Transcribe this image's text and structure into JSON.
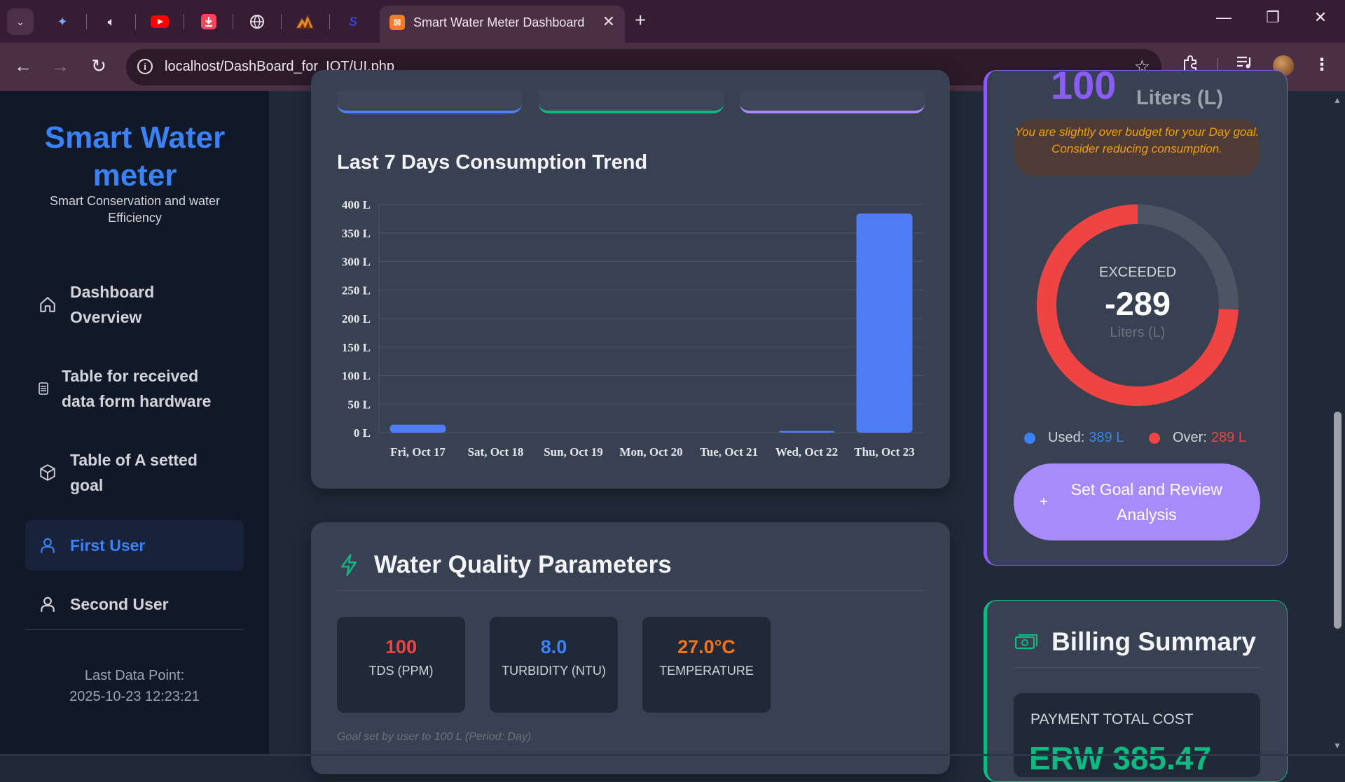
{
  "browser": {
    "active_tab_title": "Smart Water Meter Dashboard",
    "url": "localhost/DashBoard_for_IOT/UI.php",
    "pinned_tabs": [
      "gemini-icon",
      "audio-icon",
      "youtube-icon",
      "download-icon",
      "globe-icon",
      "matlab-icon",
      "s-icon"
    ]
  },
  "sidebar": {
    "brand": "Smart Water meter",
    "tagline": "Smart Conservation and water Efficiency",
    "items": [
      {
        "label": "Dashboard Overview",
        "icon": "home-icon",
        "active": false
      },
      {
        "label": "Table for received data form hardware",
        "icon": "list-icon",
        "active": false
      },
      {
        "label": "Table of A setted goal",
        "icon": "cube-icon",
        "active": false
      },
      {
        "label": "First User",
        "icon": "user-icon",
        "active": true
      },
      {
        "label": "Second User",
        "icon": "user-icon",
        "active": false
      }
    ],
    "last_point_label": "Last Data Point:",
    "last_point_value": "2025-10-23 12:23:21"
  },
  "chart_data": {
    "type": "bar",
    "title": "Last 7 Days Consumption Trend",
    "categories": [
      "Fri, Oct 17",
      "Sat, Oct 18",
      "Sun, Oct 19",
      "Mon, Oct 20",
      "Tue, Oct 21",
      "Wed, Oct 22",
      "Thu, Oct 23"
    ],
    "values": [
      14,
      0,
      0,
      0,
      0,
      3,
      384
    ],
    "ylim": [
      0,
      400
    ],
    "yticks": [
      0,
      50,
      100,
      150,
      200,
      250,
      300,
      350,
      400
    ],
    "ytick_suffix": " L",
    "grid": true,
    "colors": {
      "bar": "#4f7df5",
      "grid": "#4b5563",
      "text": "#e5e7eb"
    }
  },
  "water_quality": {
    "title": "Water Quality Parameters",
    "params": [
      {
        "value": "100",
        "label": "TDS (PPM)",
        "color": "#ef4444"
      },
      {
        "value": "8.0",
        "label": "TURBIDITY (NTU)",
        "color": "#3b82f6"
      },
      {
        "value": "27.0°C",
        "label": "TEMPERATURE",
        "color": "#f97316"
      }
    ],
    "goal_note": "Goal set by user to 100 L (Period: Day)."
  },
  "goal": {
    "big_value": "100",
    "big_unit": "Liters (L)",
    "warning": "You are slightly over budget for your Day goal. Consider reducing consumption.",
    "donut_label": "EXCEEDED",
    "donut_value": "-289",
    "donut_unit": "Liters (L)",
    "used_fraction": 0.743,
    "over_fraction": 0.257,
    "legend_used_label": "Used:",
    "legend_used_value": "389 L",
    "legend_over_label": "Over:",
    "legend_over_value": "289 L",
    "colors": {
      "used": "#ef4444",
      "over": "#4b5563",
      "used_dot": "#3b82f6",
      "over_dot": "#ef4444"
    },
    "button_label": "Set Goal and Review Analysis"
  },
  "billing": {
    "title": "Billing Summary",
    "label": "PAYMENT TOTAL COST",
    "amount": "ERW 385.47"
  }
}
